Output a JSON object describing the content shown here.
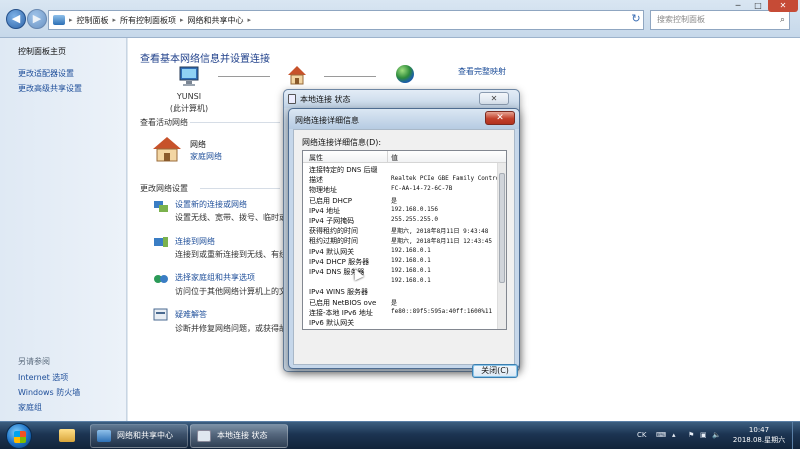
{
  "explorer": {
    "breadcrumbs": [
      "控制面板",
      "所有控制面板项",
      "网络和共享中心"
    ],
    "search_placeholder": "搜索控制面板",
    "left_nav": {
      "main_link": "控制面板主页",
      "links": [
        "更改适配器设置",
        "更改高级共享设置"
      ],
      "see_also_header": "另请参阅",
      "see_also": [
        "Internet 选项",
        "Windows 防火墙",
        "家庭组"
      ]
    },
    "main": {
      "title": "查看基本网络信息并设置连接",
      "full_map": "查看完整映射",
      "computer_name": "YUNSI",
      "computer_sub": "(此计算机)",
      "active_header": "查看活动网络",
      "network_name": "网络",
      "network_type": "家庭网络",
      "settings_header": "更改网络设置",
      "tasks": [
        {
          "title": "设置新的连接或网络",
          "desc": "设置无线、宽带、拨号、临时或"
        },
        {
          "title": "连接到网络",
          "desc": "连接到或重新连接到无线、有线、"
        },
        {
          "title": "选择家庭组和共享选项",
          "desc": "访问位于其他网络计算机上的文件"
        },
        {
          "title": "疑难解答",
          "desc": "诊断并修复网络问题，或获得故障"
        }
      ]
    }
  },
  "status_window": {
    "title": "本地连接 状态"
  },
  "details_dialog": {
    "title": "网络连接详细信息",
    "label": "网络连接详细信息(D):",
    "col_property": "属性",
    "col_value": "值",
    "rows": [
      {
        "k": "连接特定的 DNS 后缀",
        "v": ""
      },
      {
        "k": "描述",
        "v": "Realtek PCIe GBE Family Contro"
      },
      {
        "k": "物理地址",
        "v": "FC-AA-14-72-6C-7B"
      },
      {
        "k": "已启用 DHCP",
        "v": "是"
      },
      {
        "k": "IPv4 地址",
        "v": "192.168.0.156"
      },
      {
        "k": "IPv4 子网掩码",
        "v": "255.255.255.0"
      },
      {
        "k": "获得租约的时间",
        "v": "星期六, 2018年8月11日 9:43:48"
      },
      {
        "k": "租约过期的时间",
        "v": "星期六, 2018年8月11日 12:43:45"
      },
      {
        "k": "IPv4 默认网关",
        "v": "192.168.0.1"
      },
      {
        "k": "IPv4 DHCP 服务器",
        "v": "192.168.0.1"
      },
      {
        "k": "IPv4 DNS 服务器",
        "v": "192.168.0.1"
      },
      {
        "k": "",
        "v": "192.168.0.1"
      },
      {
        "k": "IPv4 WINS 服务器",
        "v": ""
      },
      {
        "k": "已启用 NetBIOS ove",
        "v": "是"
      },
      {
        "k": "连接-本地 IPv6 地址",
        "v": "fe80::89f5:595a:40ff:1600%11"
      },
      {
        "k": "IPv6 默认网关",
        "v": ""
      }
    ],
    "close_label": "关闭(C)"
  },
  "taskbar": {
    "buttons": [
      "网络和共享中心",
      "本地连接 状态"
    ],
    "tray_lang": "CK",
    "time": "10:47",
    "date": "2018.08.星期六"
  }
}
